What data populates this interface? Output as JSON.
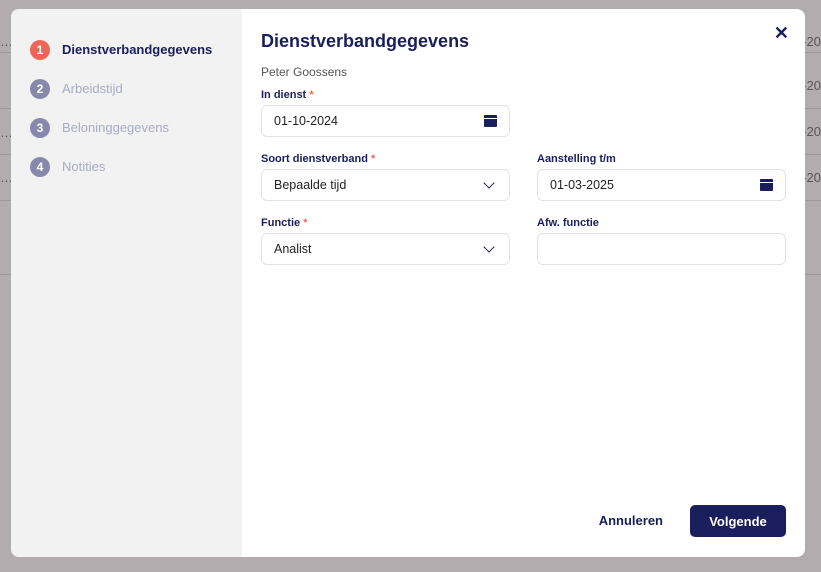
{
  "background": {
    "cells": [
      "-20",
      "-20",
      "-20",
      "-20"
    ]
  },
  "steps": [
    {
      "n": "1",
      "label": "Dienstverbandgegevens"
    },
    {
      "n": "2",
      "label": "Arbeidstijd"
    },
    {
      "n": "3",
      "label": "Beloninggegevens"
    },
    {
      "n": "4",
      "label": "Notities"
    }
  ],
  "title": "Dienstverbandgegevens",
  "employee": "Peter Goossens",
  "fields": {
    "in_dienst": {
      "label": "In dienst",
      "value": "01-10-2024",
      "req": "*"
    },
    "soort": {
      "label": "Soort dienstverband",
      "value": "Bepaalde tijd",
      "req": "*"
    },
    "aanstelling": {
      "label": "Aanstelling t/m",
      "value": "01-03-2025"
    },
    "functie": {
      "label": "Functie",
      "value": "Analist",
      "req": "*"
    },
    "afw": {
      "label": "Afw. functie",
      "value": ""
    }
  },
  "buttons": {
    "cancel": "Annuleren",
    "next": "Volgende",
    "close": "✕"
  }
}
